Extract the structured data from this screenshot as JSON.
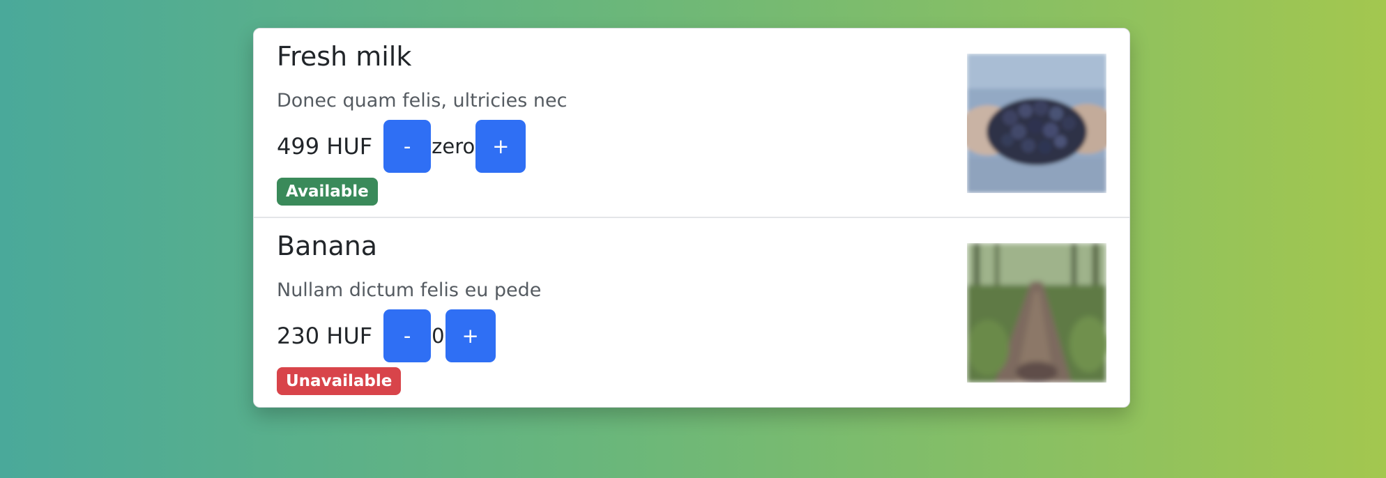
{
  "products": [
    {
      "name": "Fresh milk",
      "description": "Donec quam felis, ultricies nec",
      "price": "499 HUF",
      "minus_label": "-",
      "quantity": "zero",
      "plus_label": "+",
      "status": "Available",
      "status_color": "#3a8a5a",
      "image_icon": "berries-in-hands-image"
    },
    {
      "name": "Banana",
      "description": "Nullam dictum felis eu pede",
      "price": "230 HUF",
      "minus_label": "-",
      "quantity": "0",
      "plus_label": "+",
      "status": "Unavailable",
      "status_color": "#d8444a",
      "image_icon": "forest-path-image"
    }
  ],
  "colors": {
    "button": "#2f6ff4",
    "background_start": "#4aa99a",
    "background_end": "#a3c74f"
  }
}
